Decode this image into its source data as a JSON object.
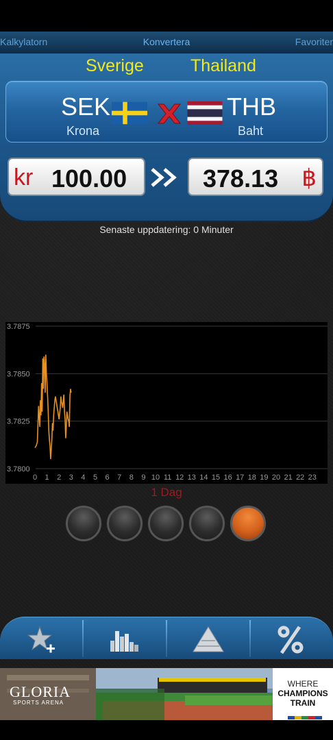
{
  "tabs": {
    "left": "Kalkylatorn",
    "center": "Konvertera",
    "right": "Favoriter"
  },
  "pair": {
    "from": {
      "country": "Sverige",
      "code": "SEK",
      "name": "Krona",
      "symbol": "kr",
      "amount": "100.00",
      "flag_icon": "sweden-flag-icon"
    },
    "to": {
      "country": "Thailand",
      "code": "THB",
      "name": "Baht",
      "symbol": "฿",
      "amount": "378.13",
      "flag_icon": "thailand-flag-icon"
    }
  },
  "update_text": "Senaste uppdatering: 0 Minuter",
  "period_label": "1 Dag",
  "period_buttons": 5,
  "period_active_index": 4,
  "colors": {
    "accent_yellow": "#f3e81a",
    "panel_blue": "#1c5589",
    "symbol_red": "#c8161d",
    "line_orange": "#e8901e",
    "active_orange": "#d4601b"
  },
  "toolbar_icons": [
    "add-favorite-icon",
    "bar-chart-icon",
    "pyramid-icon",
    "percent-icon"
  ],
  "ad": {
    "logo": "GLORIA",
    "logo_sub": "SPORTS ARENA",
    "line1": "WHERE",
    "line2": "CHAMPIONS",
    "line3": "TRAIN"
  },
  "chart_data": {
    "type": "line",
    "title": "",
    "xlabel": "",
    "ylabel": "",
    "x_ticks": [
      "0",
      "1",
      "2",
      "3",
      "4",
      "5",
      "6",
      "7",
      "8",
      "9",
      "10",
      "11",
      "12",
      "13",
      "14",
      "15",
      "16",
      "17",
      "18",
      "19",
      "20",
      "21",
      "22",
      "23"
    ],
    "y_ticks": [
      "3.7800",
      "3.7825",
      "3.7850",
      "3.7875"
    ],
    "ylim": [
      3.78,
      3.7875
    ],
    "xlim": [
      0,
      23.5
    ],
    "grid": true,
    "series": [
      {
        "x": [
          0.0,
          0.1,
          0.2,
          0.3,
          0.4,
          0.45,
          0.5,
          0.55,
          0.6,
          0.65,
          0.7,
          0.75,
          0.8,
          0.85,
          0.9,
          0.95,
          1.0,
          1.05,
          1.1,
          1.15,
          1.2,
          1.25,
          1.3,
          1.35,
          1.4,
          1.45,
          1.5,
          1.55,
          1.6,
          1.65,
          1.7,
          1.8,
          1.9,
          2.0,
          2.05,
          2.1,
          2.15,
          2.2,
          2.25,
          2.3,
          2.35,
          2.4,
          2.45,
          2.5,
          2.55,
          2.6,
          2.65,
          2.7,
          2.75,
          2.8,
          2.85,
          2.9,
          2.95,
          3.0
        ],
        "y": [
          3.7811,
          3.7812,
          3.7814,
          3.7833,
          3.7822,
          3.7836,
          3.7828,
          3.7845,
          3.783,
          3.7858,
          3.7842,
          3.7859,
          3.7855,
          3.784,
          3.786,
          3.785,
          3.7845,
          3.7838,
          3.783,
          3.782,
          3.7815,
          3.7812,
          3.7805,
          3.781,
          3.7815,
          3.7824,
          3.782,
          3.7828,
          3.7832,
          3.7836,
          3.7838,
          3.7834,
          3.783,
          3.7826,
          3.7829,
          3.7832,
          3.7838,
          3.7835,
          3.7834,
          3.7832,
          3.7836,
          3.7839,
          3.783,
          3.7826,
          3.7816,
          3.7822,
          3.783,
          3.7828,
          3.7826,
          3.7825,
          3.7822,
          3.7838,
          3.7842,
          3.784
        ]
      }
    ]
  }
}
